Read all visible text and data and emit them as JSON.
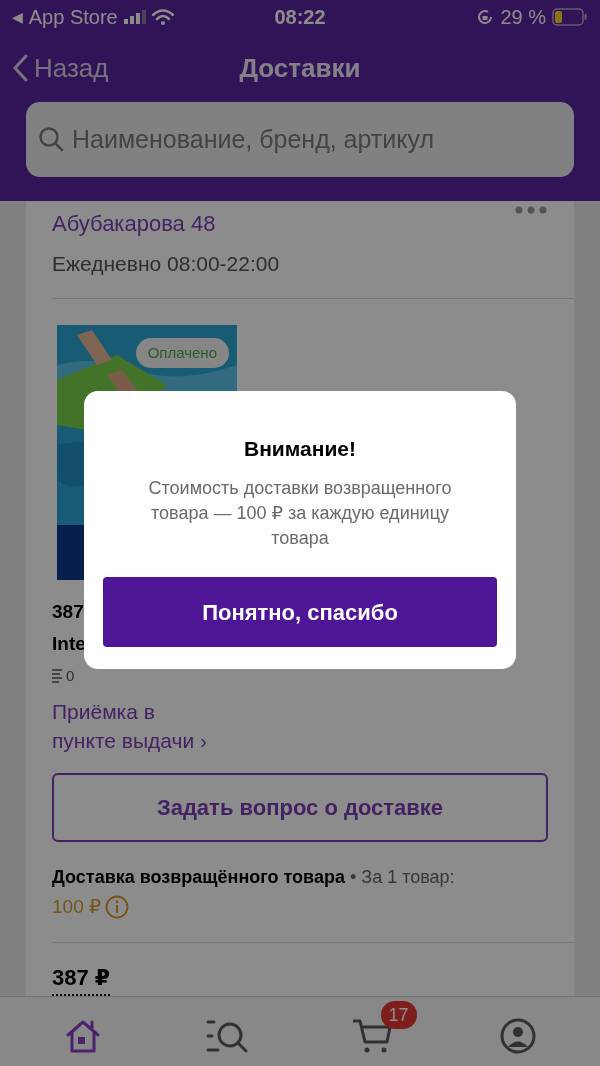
{
  "status_bar": {
    "back_arrow": "◀",
    "app": "App Store",
    "time": "08:22",
    "battery": "29 %"
  },
  "header": {
    "back": "Назад",
    "title": "Доставки",
    "search": {
      "placeholder": "Наименование, бренд, артикул"
    }
  },
  "card": {
    "address": "Абубакарова 48",
    "hours": "Ежедневно 08:00-22:00",
    "product": {
      "badge": "Оплачено",
      "price": "387",
      "name": "Inte",
      "rating": "0"
    },
    "status_link": "Приёмка в\nпункте выдачи ›",
    "ask_button": "Задать вопрос о доставке",
    "return_fee": {
      "label": "Доставка возвращённого товара",
      "note": "• За 1 товар:",
      "amount": "100 ₽"
    },
    "total": "387 ₽"
  },
  "dialog": {
    "title": "Внимание!",
    "message": "Стоимость доставки возвращенного товара — 100 ₽ за каждую единицу товара",
    "button": "Понятно, спасибо"
  },
  "tab_bar": [
    {
      "kind": "home",
      "selected": true
    },
    {
      "kind": "catalog",
      "selected": false
    },
    {
      "kind": "cart",
      "selected": false,
      "badge": "17"
    },
    {
      "kind": "profile",
      "selected": false
    }
  ]
}
